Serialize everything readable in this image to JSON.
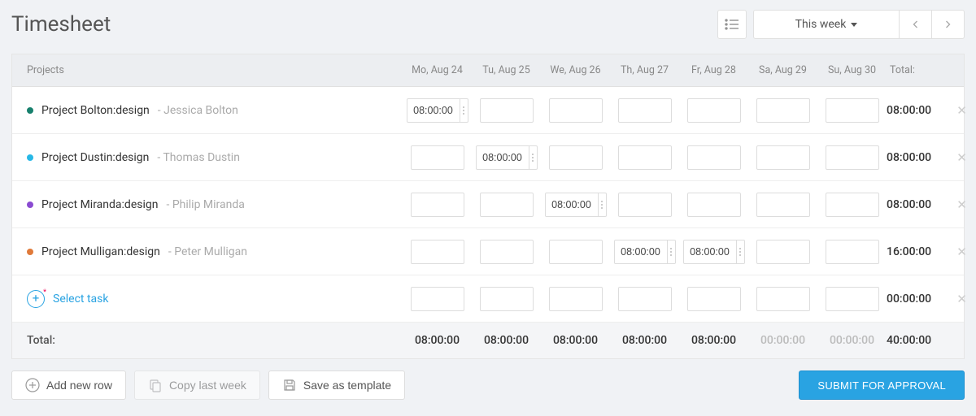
{
  "title": "Timesheet",
  "period": {
    "label": "This week"
  },
  "columns": {
    "projects": "Projects",
    "days": [
      "Mo, Aug 24",
      "Tu, Aug 25",
      "We, Aug 26",
      "Th, Aug 27",
      "Fr, Aug 28",
      "Sa, Aug 29",
      "Su, Aug 30"
    ],
    "total": "Total:"
  },
  "rows": [
    {
      "dot": "#17806d",
      "project": "Project Bolton:design",
      "person": "Jessica Bolton",
      "cells": [
        "08:00:00",
        "",
        "",
        "",
        "",
        "",
        ""
      ],
      "active_index": 0,
      "total": "08:00:00"
    },
    {
      "dot": "#27b8e6",
      "project": "Project Dustin:design",
      "person": "Thomas Dustin",
      "cells": [
        "",
        "08:00:00",
        "",
        "",
        "",
        "",
        ""
      ],
      "active_index": 1,
      "total": "08:00:00"
    },
    {
      "dot": "#8a4bd1",
      "project": "Project Miranda:design",
      "person": "Philip Miranda",
      "cells": [
        "",
        "",
        "08:00:00",
        "",
        "",
        "",
        ""
      ],
      "active_index": 2,
      "total": "08:00:00"
    },
    {
      "dot": "#e07a3a",
      "project": "Project Mulligan:design",
      "person": "Peter Mulligan",
      "cells": [
        "",
        "",
        "",
        "08:00:00",
        "08:00:00",
        "",
        ""
      ],
      "active_index": 4,
      "total": "16:00:00"
    }
  ],
  "select_task": {
    "label": "Select task",
    "cells": [
      "",
      "",
      "",
      "",
      "",
      "",
      ""
    ],
    "total": "00:00:00"
  },
  "footer": {
    "label": "Total:",
    "days": [
      "08:00:00",
      "08:00:00",
      "08:00:00",
      "08:00:00",
      "08:00:00",
      "00:00:00",
      "00:00:00"
    ],
    "grand": "40:00:00"
  },
  "actions": {
    "add_row": "Add new row",
    "copy_last_week": "Copy last week",
    "save_template": "Save as template",
    "submit": "SUBMIT FOR APPROVAL"
  }
}
